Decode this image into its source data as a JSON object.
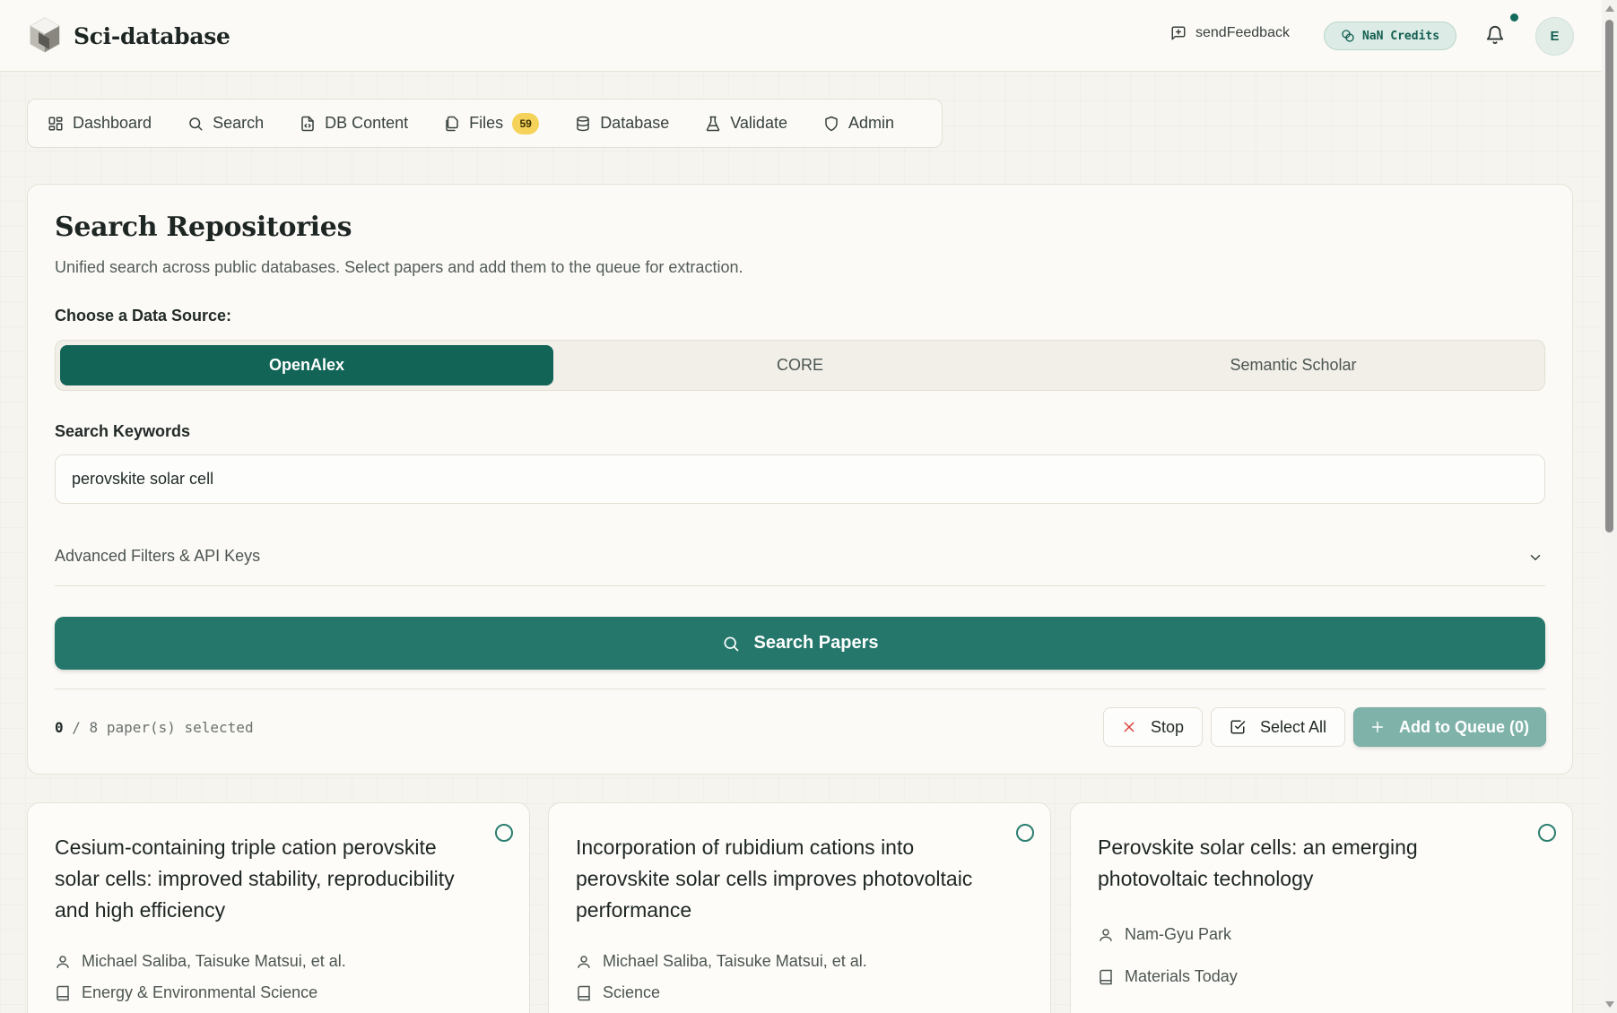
{
  "header": {
    "app_name": "Sci-database",
    "feedback_label": "sendFeedback",
    "credits_label": "NaN Credits",
    "avatar_initial": "E"
  },
  "nav": {
    "items": [
      {
        "label": "Dashboard",
        "icon": "grid-icon"
      },
      {
        "label": "Search",
        "icon": "search-icon"
      },
      {
        "label": "DB Content",
        "icon": "file-code-icon"
      },
      {
        "label": "Files",
        "icon": "files-icon",
        "badge": "59"
      },
      {
        "label": "Database",
        "icon": "database-icon"
      },
      {
        "label": "Validate",
        "icon": "flask-icon"
      },
      {
        "label": "Admin",
        "icon": "shield-icon"
      }
    ]
  },
  "search_panel": {
    "title": "Search Repositories",
    "subtitle": "Unified search across public databases. Select papers and add them to the queue for extraction.",
    "source_label": "Choose a Data Source:",
    "sources": [
      "OpenAlex",
      "CORE",
      "Semantic Scholar"
    ],
    "active_source": "OpenAlex",
    "keywords_label": "Search Keywords",
    "keywords_value": "perovskite solar cell",
    "advanced_label": "Advanced Filters & API Keys",
    "search_button": "Search Papers",
    "selected_count": "0",
    "selected_suffix": "/ 8 paper(s) selected",
    "stop_button": "Stop",
    "select_all_button": "Select All",
    "add_queue_button": "Add to Queue (0)"
  },
  "papers": [
    {
      "title": "Cesium-containing triple cation perovskite solar cells: improved stability, reproducibility and high efficiency",
      "authors": "Michael Saliba, Taisuke Matsui, et al.",
      "journal": "Energy & Environmental Science"
    },
    {
      "title": "Incorporation of rubidium cations into perovskite solar cells improves photovoltaic performance",
      "authors": "Michael Saliba, Taisuke Matsui, et al.",
      "journal": "Science"
    },
    {
      "title": "Perovskite solar cells: an emerging photovoltaic technology",
      "authors": "Nam-Gyu Park",
      "journal": "Materials Today"
    }
  ],
  "colors": {
    "accent": "#116456",
    "button": "#25776b",
    "badge": "#f5d35a"
  }
}
